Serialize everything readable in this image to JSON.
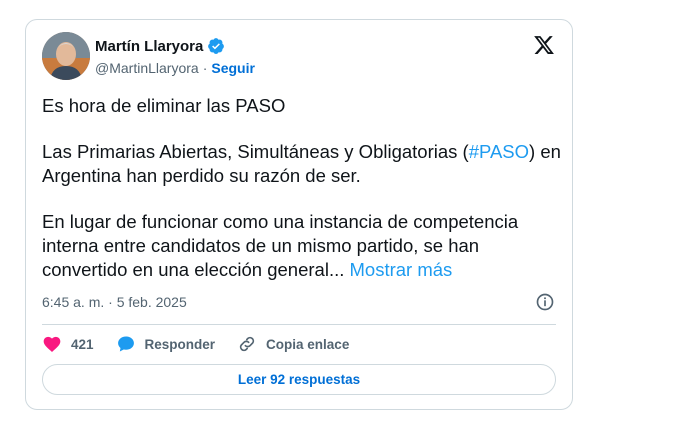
{
  "tweet": {
    "author_name": "Martín Llaryora",
    "handle": "@MartinLlaryora",
    "separator": "·",
    "follow_label": "Seguir",
    "para1": "Es hora de eliminar las PASO",
    "para2_start": "Las Primarias Abiertas, Simultáneas y Obligatorias (",
    "hashtag": "#PASO",
    "para2_end": ") en Argentina han perdido su razón de ser.",
    "para3": "En lugar de funcionar como una instancia de competencia interna entre candidatos de un mismo partido, se han convertido en una elección general...",
    "show_more": "Mostrar más",
    "timestamp": "6:45 a. m. · 5 feb. 2025",
    "likes": "421",
    "reply_label": "Responder",
    "copy_label": "Copia enlace",
    "read_replies": "Leer 92 respuestas"
  },
  "icons": {
    "verified": "verified-badge-icon",
    "logo": "x-logo-icon",
    "info": "info-icon",
    "like": "heart-icon",
    "reply": "speech-bubble-icon",
    "copy": "link-icon"
  },
  "colors": {
    "link": "#1d9bf0",
    "follow": "#006fd6",
    "like": "#f91880",
    "reply": "#1d9bf0",
    "secondary": "#536471",
    "border": "#cfd9de"
  }
}
